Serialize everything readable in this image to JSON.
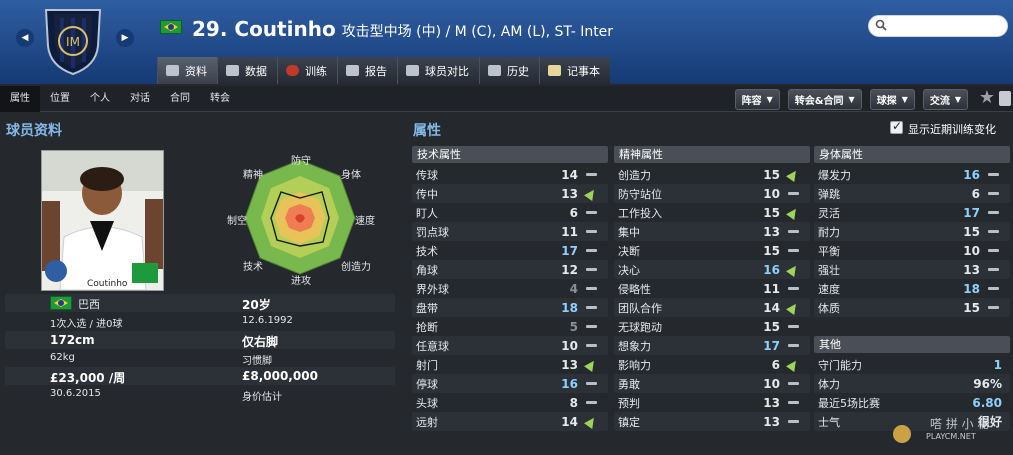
{
  "header": {
    "player_number_name": "29. Coutinho",
    "position_club": "攻击型中场 (中) / M (C), AM (L), ST- Inter",
    "nav_prev": "◀",
    "nav_next": "▶"
  },
  "search": {
    "placeholder": ""
  },
  "tabs": [
    {
      "label": "资料",
      "icon": "profile-icon"
    },
    {
      "label": "数据",
      "icon": "stats-icon"
    },
    {
      "label": "训练",
      "icon": "training-icon"
    },
    {
      "label": "报告",
      "icon": "report-icon"
    },
    {
      "label": "球员对比",
      "icon": "compare-icon"
    },
    {
      "label": "历史",
      "icon": "history-icon"
    },
    {
      "label": "记事本",
      "icon": "notes-icon"
    }
  ],
  "subnav": [
    "属性",
    "位置",
    "个人",
    "对话",
    "合同",
    "转会"
  ],
  "actions": [
    {
      "label": "阵容"
    },
    {
      "label": "转会&合同"
    },
    {
      "label": "球探"
    },
    {
      "label": "交流"
    }
  ],
  "profile": {
    "section_title": "球员资料",
    "photo_caption": "Coutinho",
    "radar_labels": {
      "top": "防守",
      "top_right": "身体",
      "right": "速度",
      "bottom_right": "创造力",
      "bottom": "进攻",
      "bottom_left": "技术",
      "left": "制空",
      "top_left": "精神"
    },
    "nationality": "巴西",
    "caps": "1次入选 / 进0球",
    "height": "172cm",
    "weight": "62kg",
    "wage": "£23,000 /周",
    "contract_end": "30.6.2015",
    "age": "20岁",
    "dob": "12.6.1992",
    "foot": "仅右脚",
    "foot_label": "习惯脚",
    "value": "£8,000,000",
    "value_label": "身价估计"
  },
  "attributes": {
    "section_title": "属性",
    "show_training_label": "显示近期训练变化",
    "technical": {
      "title": "技术属性",
      "items": [
        {
          "name": "传球",
          "value": "14",
          "trend": "flat",
          "tone": "mid"
        },
        {
          "name": "传中",
          "value": "13",
          "trend": "up",
          "tone": "mid"
        },
        {
          "name": "盯人",
          "value": "6",
          "trend": "flat",
          "tone": "mid"
        },
        {
          "name": "罚点球",
          "value": "11",
          "trend": "flat",
          "tone": "mid"
        },
        {
          "name": "技术",
          "value": "17",
          "trend": "flat",
          "tone": "hi"
        },
        {
          "name": "角球",
          "value": "12",
          "trend": "flat",
          "tone": "mid"
        },
        {
          "name": "界外球",
          "value": "4",
          "trend": "flat",
          "tone": "lo"
        },
        {
          "name": "盘带",
          "value": "18",
          "trend": "flat",
          "tone": "hi"
        },
        {
          "name": "抢断",
          "value": "5",
          "trend": "flat",
          "tone": "lo"
        },
        {
          "name": "任意球",
          "value": "10",
          "trend": "flat",
          "tone": "mid"
        },
        {
          "name": "射门",
          "value": "13",
          "trend": "up",
          "tone": "mid"
        },
        {
          "name": "停球",
          "value": "16",
          "trend": "flat",
          "tone": "hi"
        },
        {
          "name": "头球",
          "value": "8",
          "trend": "flat",
          "tone": "mid"
        },
        {
          "name": "远射",
          "value": "14",
          "trend": "up",
          "tone": "mid"
        }
      ]
    },
    "mental": {
      "title": "精神属性",
      "items": [
        {
          "name": "创造力",
          "value": "15",
          "trend": "up",
          "tone": "mid"
        },
        {
          "name": "防守站位",
          "value": "10",
          "trend": "flat",
          "tone": "mid"
        },
        {
          "name": "工作投入",
          "value": "15",
          "trend": "up",
          "tone": "mid"
        },
        {
          "name": "集中",
          "value": "13",
          "trend": "flat",
          "tone": "mid"
        },
        {
          "name": "决断",
          "value": "15",
          "trend": "flat",
          "tone": "mid"
        },
        {
          "name": "决心",
          "value": "16",
          "trend": "up",
          "tone": "hi"
        },
        {
          "name": "侵略性",
          "value": "11",
          "trend": "flat",
          "tone": "mid"
        },
        {
          "name": "团队合作",
          "value": "14",
          "trend": "up",
          "tone": "mid"
        },
        {
          "name": "无球跑动",
          "value": "15",
          "trend": "flat",
          "tone": "mid"
        },
        {
          "name": "想象力",
          "value": "17",
          "trend": "flat",
          "tone": "hi"
        },
        {
          "name": "影响力",
          "value": "6",
          "trend": "up",
          "tone": "mid"
        },
        {
          "name": "勇敢",
          "value": "10",
          "trend": "flat",
          "tone": "mid"
        },
        {
          "name": "预判",
          "value": "13",
          "trend": "flat",
          "tone": "mid"
        },
        {
          "name": "镇定",
          "value": "13",
          "trend": "flat",
          "tone": "mid"
        }
      ]
    },
    "physical": {
      "title": "身体属性",
      "items": [
        {
          "name": "爆发力",
          "value": "16",
          "trend": "flat",
          "tone": "hi"
        },
        {
          "name": "弹跳",
          "value": "6",
          "trend": "flat",
          "tone": "mid"
        },
        {
          "name": "灵活",
          "value": "17",
          "trend": "flat",
          "tone": "hi"
        },
        {
          "name": "耐力",
          "value": "15",
          "trend": "flat",
          "tone": "mid"
        },
        {
          "name": "平衡",
          "value": "10",
          "trend": "flat",
          "tone": "mid"
        },
        {
          "name": "强壮",
          "value": "13",
          "trend": "flat",
          "tone": "mid"
        },
        {
          "name": "速度",
          "value": "18",
          "trend": "flat",
          "tone": "hi"
        },
        {
          "name": "体质",
          "value": "15",
          "trend": "flat",
          "tone": "mid"
        }
      ]
    },
    "other": {
      "title": "其他",
      "items": [
        {
          "name": "守门能力",
          "value": "1",
          "tone": "hi"
        },
        {
          "name": "体力",
          "value": "96%",
          "tone": "mid"
        },
        {
          "name": "最近5场比赛",
          "value": "6.80",
          "tone": "hi"
        },
        {
          "name": "士气",
          "value": "很好",
          "tone": "mid"
        }
      ]
    }
  },
  "watermark": "PLAYCM.NET"
}
